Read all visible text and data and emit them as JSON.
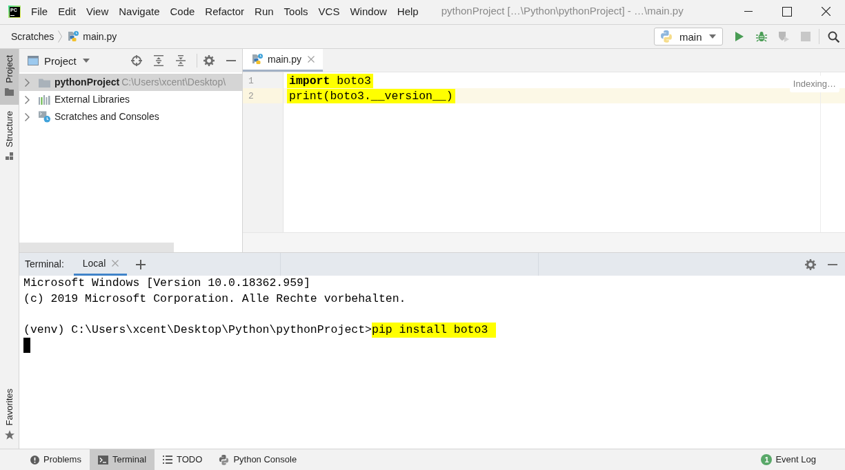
{
  "window": {
    "title": "pythonProject […\\Python\\pythonProject] - …\\main.py",
    "logo": "PC"
  },
  "menu": [
    "File",
    "Edit",
    "View",
    "Navigate",
    "Code",
    "Refactor",
    "Run",
    "Tools",
    "VCS",
    "Window",
    "Help"
  ],
  "breadcrumbs": [
    {
      "label": "Scratches",
      "kind": "text"
    },
    {
      "label": "main.py",
      "kind": "python_file"
    }
  ],
  "run_config": {
    "label": "main"
  },
  "toolbar": [
    {
      "kind": "run",
      "disabled": false
    },
    {
      "kind": "debug",
      "disabled": false
    },
    {
      "kind": "coverage",
      "disabled": true
    },
    {
      "kind": "stop",
      "disabled": true
    },
    {
      "kind": "search",
      "disabled": false
    }
  ],
  "left_tool_tabs": [
    {
      "label": "Project",
      "kind": "project",
      "selected": true
    },
    {
      "label": "Structure",
      "kind": "structure",
      "selected": false
    }
  ],
  "left_bottom_tabs": [
    {
      "label": "Favorites",
      "kind": "favorites",
      "selected": false
    }
  ],
  "project_panel": {
    "title": "Project",
    "tree": [
      {
        "label": "pythonProject",
        "path": "C:\\Users\\xcent\\Desktop\\",
        "kind": "project",
        "expanded": false,
        "selected": true
      },
      {
        "label": "External Libraries",
        "kind": "libraries",
        "expanded": false,
        "selected": false
      },
      {
        "label": "Scratches and Consoles",
        "kind": "scratches",
        "expanded": false,
        "selected": false
      }
    ]
  },
  "editor": {
    "tabs": [
      {
        "label": "main.py",
        "selected": true
      }
    ],
    "lines": [
      {
        "number": "1",
        "code": "**import** boto3",
        "current": false,
        "highlighted": true
      },
      {
        "number": "2",
        "code": "print(boto3.__version__)",
        "current": true,
        "highlighted": true
      }
    ],
    "status": "Indexing…"
  },
  "terminal": {
    "title": "Terminal:",
    "tabs": [
      {
        "label": "Local",
        "selected": true
      }
    ],
    "blocks": [
      {
        "lines": [
          {
            "segments": [
              {
                "text": "Microsoft Windows [Version 10.0.18362.959]",
                "highlighted": false
              }
            ]
          },
          {
            "segments": [
              {
                "text": "(c) 2019 Microsoft Corporation. Alle Rechte vorbehalten.",
                "highlighted": false
              }
            ]
          }
        ]
      },
      {
        "lines": [
          {
            "segments": [
              {
                "text": "(venv) C:\\Users\\xcent\\Desktop\\Python\\pythonProject>",
                "highlighted": false
              },
              {
                "text": "pip install boto3",
                "highlighted": true
              }
            ]
          }
        ]
      }
    ]
  },
  "bottom_tabs": [
    {
      "label": "Problems",
      "kind": "problems",
      "selected": false
    },
    {
      "label": "Terminal",
      "kind": "terminal",
      "selected": true
    },
    {
      "label": "TODO",
      "kind": "todo",
      "selected": false
    },
    {
      "label": "Python Console",
      "kind": "python_console",
      "selected": false
    }
  ],
  "event_log": {
    "label": "Event Log",
    "count": "1"
  }
}
